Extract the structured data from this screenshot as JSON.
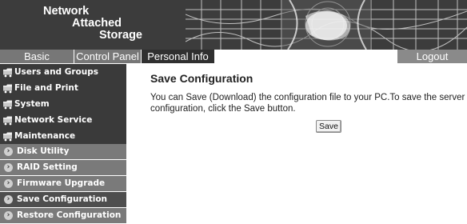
{
  "header": {
    "brand": {
      "line1": "Network",
      "line2": "Attached",
      "line3": "Storage"
    }
  },
  "tabs": [
    {
      "label": "Basic"
    },
    {
      "label": "Control Panel"
    },
    {
      "label": "Personal Info"
    }
  ],
  "logout": {
    "label": "Logout"
  },
  "sidebar": {
    "groups": [
      {
        "label": "Users and Groups",
        "icon": "network-folder-icon"
      },
      {
        "label": "File and Print",
        "icon": "network-folder-icon"
      },
      {
        "label": "System",
        "icon": "network-folder-icon"
      },
      {
        "label": "Network Service",
        "icon": "network-folder-icon"
      },
      {
        "label": "Maintenance",
        "icon": "network-folder-icon"
      }
    ],
    "subitems": [
      {
        "label": "Disk Utility",
        "icon": "arrow-right-icon"
      },
      {
        "label": "RAID Setting",
        "icon": "arrow-right-icon"
      },
      {
        "label": "Firmware Upgrade",
        "icon": "arrow-right-icon"
      },
      {
        "label": "Save Configuration",
        "icon": "arrow-right-icon"
      },
      {
        "label": "Restore Configuration",
        "icon": "arrow-right-icon"
      }
    ]
  },
  "main": {
    "title": "Save Configuration",
    "description_line1": "You can Save (Download) the configuration file to your PC.To save the server",
    "description_line2": "configuration, click the Save button.",
    "save_label": "Save"
  },
  "colors": {
    "header_bg": "#3c3c3c",
    "sidebar_group_bg": "#3a3a3a",
    "sidebar_sub_bg": "#7a7a7a",
    "tab_active_bg": "#303030"
  }
}
